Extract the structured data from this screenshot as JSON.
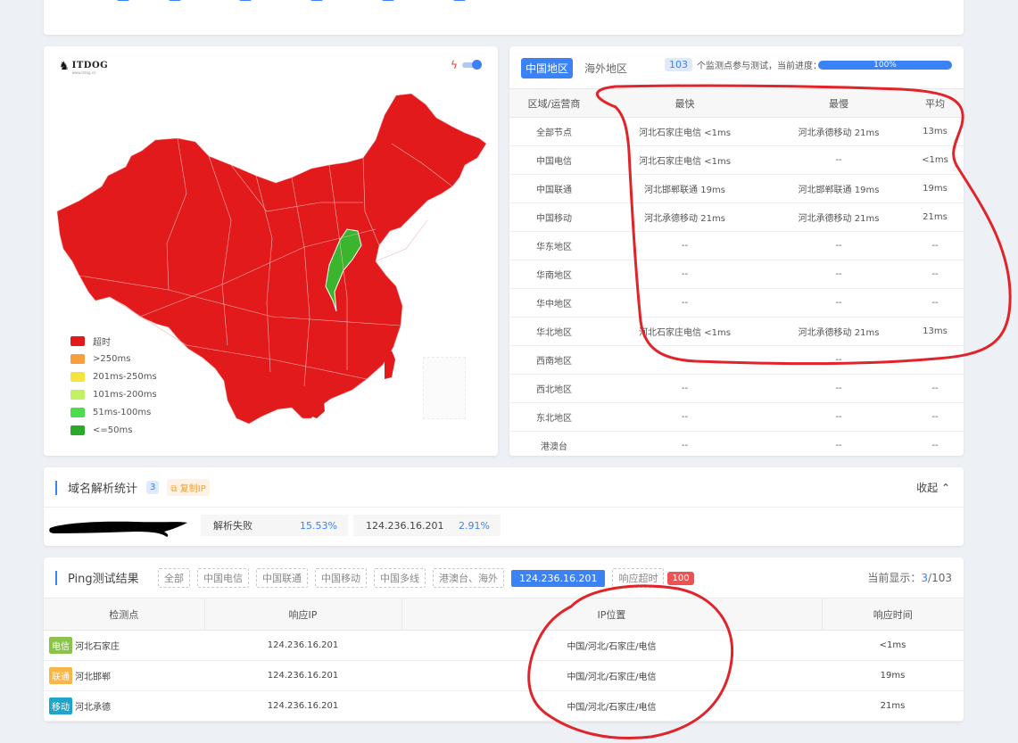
{
  "map": {
    "logo_text": "ITDOG",
    "logo_sub": "www.itdog.cn",
    "legend": [
      {
        "label": "超时",
        "color": "#e31a1c"
      },
      {
        "label": ">250ms",
        "color": "#f5a03c"
      },
      {
        "label": "201ms-250ms",
        "color": "#f5e43c"
      },
      {
        "label": "101ms-200ms",
        "color": "#c2f263"
      },
      {
        "label": "51ms-100ms",
        "color": "#4ddc4d"
      },
      {
        "label": "<=50ms",
        "color": "#2ca82c"
      }
    ],
    "colors": {
      "timeout": "#e31a1c",
      "fast": "#3cb52e"
    }
  },
  "speed": {
    "tab_china": "中国地区",
    "tab_overseas": "海外地区",
    "monitor_count": "103",
    "monitor_text": "个监测点参与测试，当前进度：",
    "progress_label": "100%",
    "progress_value": 1.0,
    "headers": [
      "区域/运营商",
      "最快",
      "最慢",
      "平均"
    ],
    "rows": [
      [
        "全部节点",
        "河北石家庄电信 <1ms",
        "河北承德移动 21ms",
        "13ms"
      ],
      [
        "中国电信",
        "河北石家庄电信 <1ms",
        "--",
        "<1ms"
      ],
      [
        "中国联通",
        "河北邯郸联通 19ms",
        "河北邯郸联通 19ms",
        "19ms"
      ],
      [
        "中国移动",
        "河北承德移动 21ms",
        "河北承德移动 21ms",
        "21ms"
      ],
      [
        "华东地区",
        "--",
        "--",
        "--"
      ],
      [
        "华南地区",
        "--",
        "--",
        "--"
      ],
      [
        "华中地区",
        "--",
        "--",
        "--"
      ],
      [
        "华北地区",
        "河北石家庄电信 <1ms",
        "河北承德移动 21ms",
        "13ms"
      ],
      [
        "西南地区",
        "--",
        "--",
        "--"
      ],
      [
        "西北地区",
        "--",
        "--",
        "--"
      ],
      [
        "东北地区",
        "--",
        "--",
        "--"
      ],
      [
        "港澳台",
        "--",
        "--",
        "--"
      ]
    ]
  },
  "dns": {
    "title": "域名解析统计",
    "count": "3",
    "copy_label": "复制IP",
    "collapse_label": "收起",
    "items": [
      {
        "key": "解析失败",
        "value": "15.53%"
      },
      {
        "key": "124.236.16.201",
        "value": "2.91%"
      }
    ]
  },
  "ping": {
    "title": "Ping测试结果",
    "filters": [
      "全部",
      "中国电信",
      "中国联通",
      "中国移动",
      "中国多线",
      "港澳台、海外"
    ],
    "active_filter": "124.236.16.201",
    "timeout_label": "响应超时",
    "timeout_count": "100",
    "display_prefix": "当前显示：",
    "display_current": "3",
    "display_total": "/103",
    "headers": [
      "检测点",
      "响应IP",
      "IP位置",
      "响应时间"
    ],
    "rows": [
      {
        "isp": "电信",
        "isp_color": "#8bc34a",
        "node": "河北石家庄",
        "ip": "124.236.16.201",
        "location": "中国/河北/石家庄/电信",
        "time": "<1ms"
      },
      {
        "isp": "联通",
        "isp_color": "#f7b54a",
        "node": "河北邯郸",
        "ip": "124.236.16.201",
        "location": "中国/河北/石家庄/电信",
        "time": "19ms"
      },
      {
        "isp": "移动",
        "isp_color": "#1ea5c9",
        "node": "河北承德",
        "ip": "124.236.16.201",
        "location": "中国/河北/石家庄/电信",
        "time": "21ms"
      }
    ]
  }
}
